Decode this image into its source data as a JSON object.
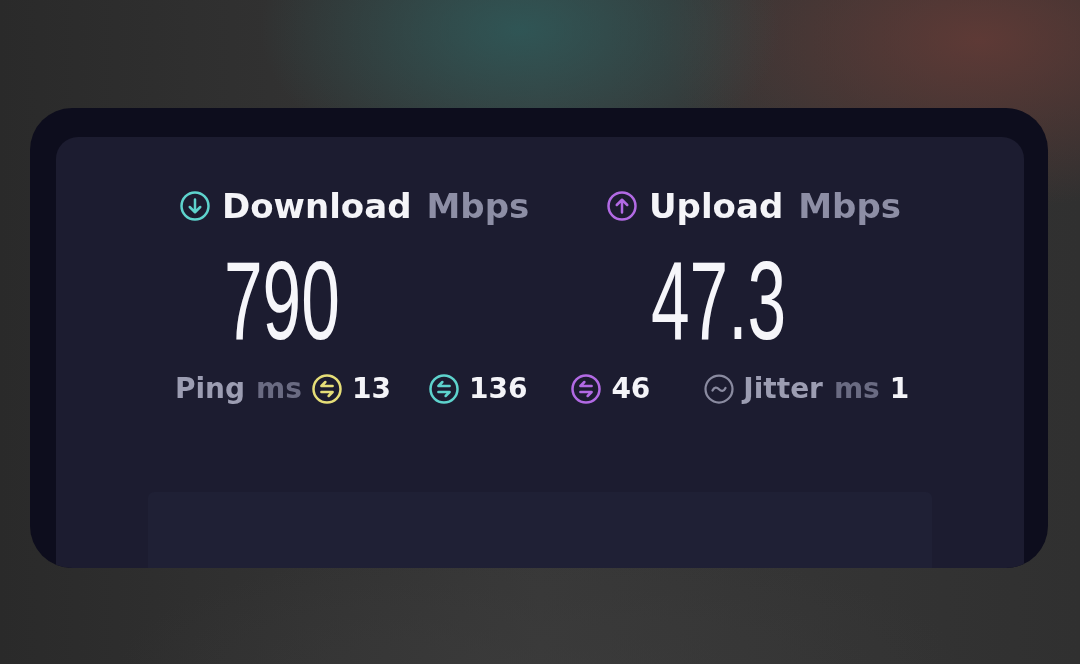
{
  "results": [
    {
      "kind": "download",
      "label": "Download",
      "unit": "Mbps",
      "value": "790",
      "color": "#5ed3cd"
    },
    {
      "kind": "upload",
      "label": "Upload",
      "unit": "Mbps",
      "value": "47.3",
      "color": "#b26ae4"
    }
  ],
  "ping": {
    "label": "Ping",
    "unit": "ms",
    "readings": [
      {
        "value": "13",
        "color": "#e6de78"
      },
      {
        "value": "136",
        "color": "#5ed3cd"
      },
      {
        "value": "46",
        "color": "#b26ae4"
      }
    ]
  },
  "jitter": {
    "label": "Jitter",
    "unit": "ms",
    "value": "1"
  }
}
